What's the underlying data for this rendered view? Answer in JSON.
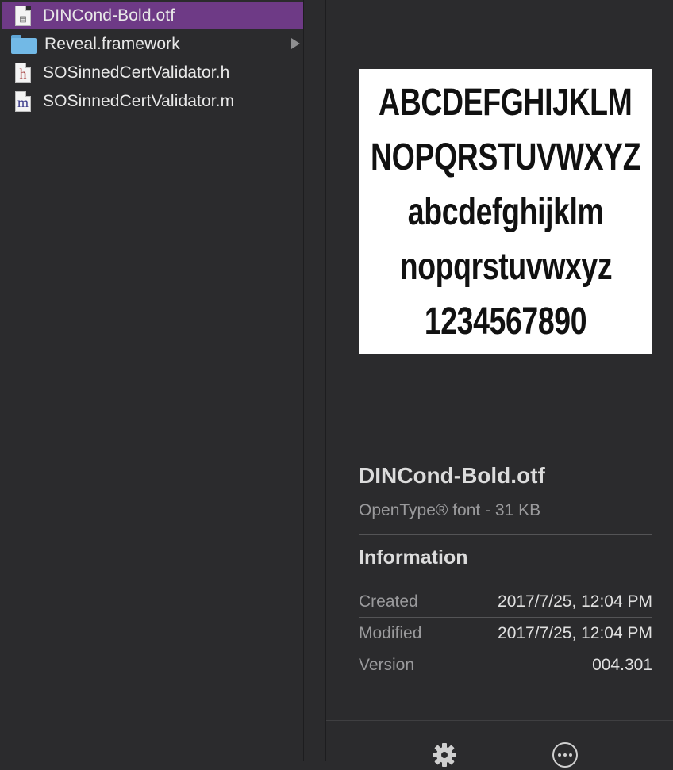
{
  "files": [
    {
      "name": "DINCond-Bold.otf",
      "icon": "font-file-icon",
      "selected": true
    },
    {
      "name": "Reveal.framework",
      "icon": "folder-icon",
      "has_children": true
    },
    {
      "name": "SOSinnedCertValidator.h",
      "icon": "header-file-icon",
      "glyph": "h"
    },
    {
      "name": "SOSinnedCertValidator.m",
      "icon": "objc-file-icon",
      "glyph": "m"
    }
  ],
  "preview": {
    "sample_lines": [
      "ABCDEFGHIJKLM",
      "NOPQRSTUVWXYZ",
      "abcdefghijklm",
      "nopqrstuvwxyz",
      "1234567890"
    ],
    "title": "DINCond-Bold.otf",
    "kind": "OpenType® font - 31 KB",
    "info_heading": "Information",
    "info": [
      {
        "key": "Created",
        "value": "2017/7/25, 12:04 PM"
      },
      {
        "key": "Modified",
        "value": "2017/7/25, 12:04 PM"
      },
      {
        "key": "Version",
        "value": "004.301"
      }
    ]
  },
  "actions": {
    "settings_icon": "gear-icon",
    "more_icon": "more-icon"
  },
  "colors": {
    "selection": "#6e3a86",
    "background": "#2b2b2d",
    "folder": "#72b9e6"
  }
}
